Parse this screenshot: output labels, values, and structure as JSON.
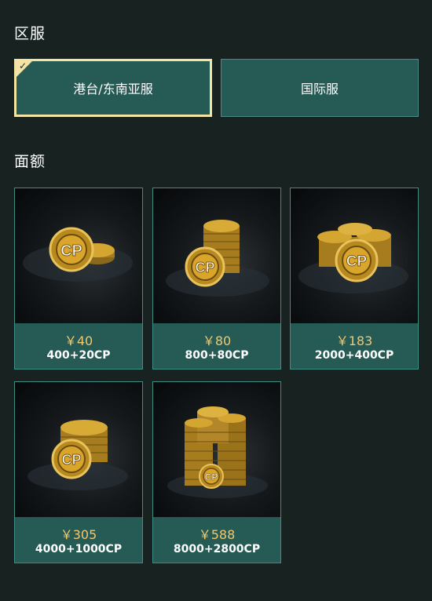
{
  "server_section": {
    "title": "区服",
    "options": [
      {
        "label": "港台/东南亚服",
        "selected": true
      },
      {
        "label": "国际服",
        "selected": false
      }
    ],
    "check_icon": "check-icon"
  },
  "denom_section": {
    "title": "面额",
    "items": [
      {
        "price": "￥40",
        "amount": "400+20CP",
        "coin_label": "CP"
      },
      {
        "price": "￥80",
        "amount": "800+80CP",
        "coin_label": "CP"
      },
      {
        "price": "￥183",
        "amount": "2000+400CP",
        "coin_label": "CP"
      },
      {
        "price": "￥305",
        "amount": "4000+1000CP",
        "coin_label": "CP"
      },
      {
        "price": "￥588",
        "amount": "8000+2800CP",
        "coin_label": "CP"
      }
    ]
  },
  "colors": {
    "background": "#182221",
    "card_teal": "#255a55",
    "selected_border": "#f3e3a4",
    "price_gold": "#f0c870"
  }
}
